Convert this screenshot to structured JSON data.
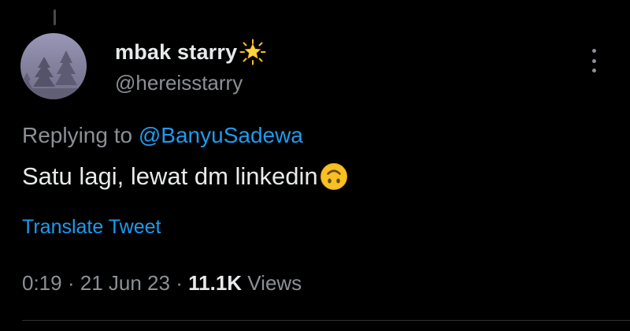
{
  "tweet": {
    "author": {
      "display_name": "mbak starry",
      "badge_emoji": "🌟",
      "handle": "@hereisstarry"
    },
    "reply": {
      "prefix": "Replying to",
      "mention": "@BanyuSadewa"
    },
    "text": "Satu lagi, lewat dm linkedin",
    "text_emoji": "🙃",
    "translate_label": "Translate Tweet",
    "meta": {
      "time": "0:19",
      "separator": "·",
      "date": "21 Jun 23",
      "views_count": "11.1K",
      "views_label": "Views"
    },
    "more_menu_icon": "more-vertical-icon"
  },
  "colors": {
    "background": "#000000",
    "primary_text": "#e7e9ea",
    "secondary_text": "#8b9096",
    "link": "#1d9bf0"
  }
}
